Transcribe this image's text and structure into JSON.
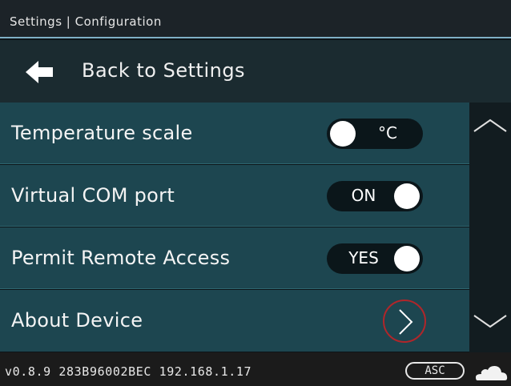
{
  "header": {
    "title": "Settings | Configuration"
  },
  "back": {
    "label": "Back to Settings",
    "icon": "arrow-left-icon"
  },
  "settings": [
    {
      "label": "Temperature scale",
      "toggle_text": "°C",
      "knob": "left"
    },
    {
      "label": "Virtual COM port",
      "toggle_text": "ON",
      "knob": "right"
    },
    {
      "label": "Permit Remote Access",
      "toggle_text": "YES",
      "knob": "right"
    },
    {
      "label": "About Device",
      "icon": "chevron-right-icon"
    }
  ],
  "scroll": {
    "up_icon": "chevron-up-icon",
    "down_icon": "chevron-down-icon"
  },
  "status": {
    "text": "v0.8.9 283B96002BEC 192.168.1.17",
    "badge": "ASC",
    "icon": "cloud-icon"
  },
  "colors": {
    "list_background": "#1d4650",
    "accent_line": "#7fb0c6",
    "highlight_circle": "#b0262a"
  }
}
